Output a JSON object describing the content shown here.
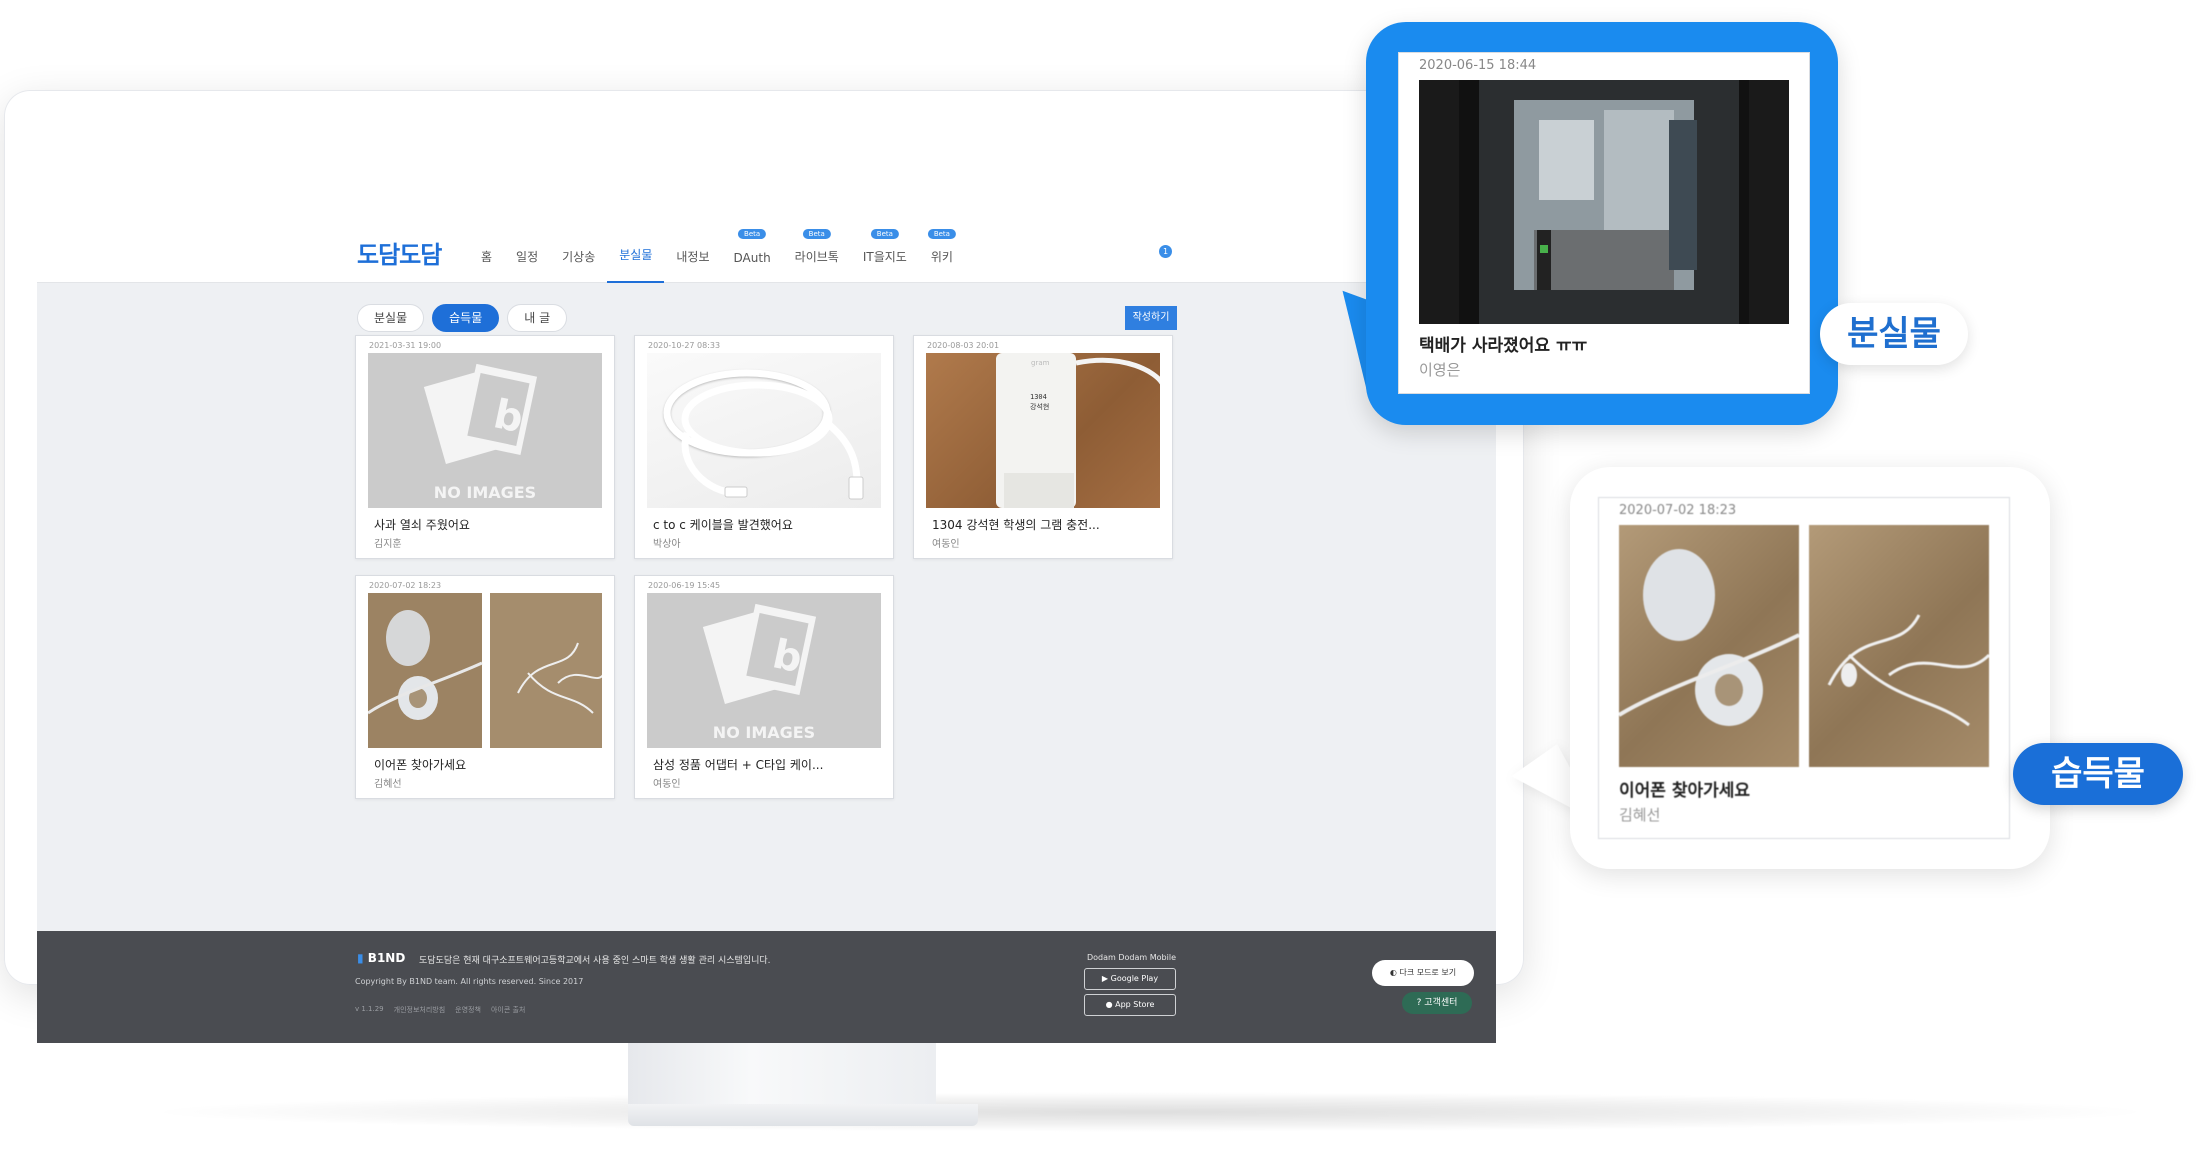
{
  "header": {
    "logo": "도담도담",
    "nav": [
      {
        "label": "홈",
        "beta": ""
      },
      {
        "label": "일정",
        "beta": ""
      },
      {
        "label": "기상송",
        "beta": ""
      },
      {
        "label": "분실물",
        "beta": ""
      },
      {
        "label": "내정보",
        "beta": ""
      },
      {
        "label": "DAuth",
        "beta": "Beta"
      },
      {
        "label": "라이브톡",
        "beta": "Beta"
      },
      {
        "label": "IT을지도",
        "beta": "Beta"
      },
      {
        "label": "위키",
        "beta": "Beta"
      }
    ],
    "notification_count": "1"
  },
  "filters": {
    "lost": "분실물",
    "found": "습득물",
    "mine": "내 글",
    "selected": "습득물",
    "write": "작성하기"
  },
  "cards": [
    {
      "date": "2021-03-31 19:00",
      "title": "사과 열쇠 주웠어요",
      "author": "김지훈",
      "image": "no-images",
      "noimg_text": "NO IMAGES"
    },
    {
      "date": "2020-10-27 08:33",
      "title": "c to c 케이블을 발견했어요",
      "author": "박상아",
      "image": "usb-c-cable"
    },
    {
      "date": "2020-08-03 20:01",
      "title": "1304 강석현 학생의 그램 충전...",
      "author": "여동인",
      "image": "gram-charger",
      "charger_text": "1304\n강석현",
      "brand": "gram"
    },
    {
      "date": "2020-07-02 18:23",
      "title": "이어폰 찾아가세요",
      "author": "김혜선",
      "image": "earphones"
    },
    {
      "date": "2020-06-19 15:45",
      "title": "삼성 정품 어댑터 + C타입 케이...",
      "author": "여동인",
      "image": "no-images",
      "noimg_text": "NO IMAGES"
    }
  ],
  "footer": {
    "brand": "B1ND",
    "description": "도담도담은 현재 대구소프트웨어고등학교에서 사용 중인 스마트 학생 생활 관리 시스템입니다.",
    "copyright": "Copyright By B1ND team. All rights reserved. Since 2017",
    "version": "v 1.1.29",
    "links": [
      "개인정보처리방침",
      "운영정책",
      "아이콘 출처"
    ],
    "mobile_title": "Dodam Dodam Mobile",
    "google_play": "Google Play",
    "app_store": "App Store",
    "dark_mode": "다크 모드로 보기",
    "support": "고객센터"
  },
  "callouts": {
    "lost": {
      "date": "2020-06-15 18:44",
      "title": "택배가 사라졌어요 ㅠㅠ",
      "author": "이영은",
      "tag": "분실물",
      "image": "door-photo"
    },
    "found": {
      "date": "2020-07-02 18:23",
      "title": "이어폰 찾아가세요",
      "author": "김혜선",
      "tag": "습득물",
      "image": "earphones"
    }
  },
  "colors": {
    "brand_blue": "#1e6fd8",
    "callout_blue": "#1a8bef",
    "footer_bg": "#4a4c51",
    "screen_bg": "#eef0f3"
  }
}
